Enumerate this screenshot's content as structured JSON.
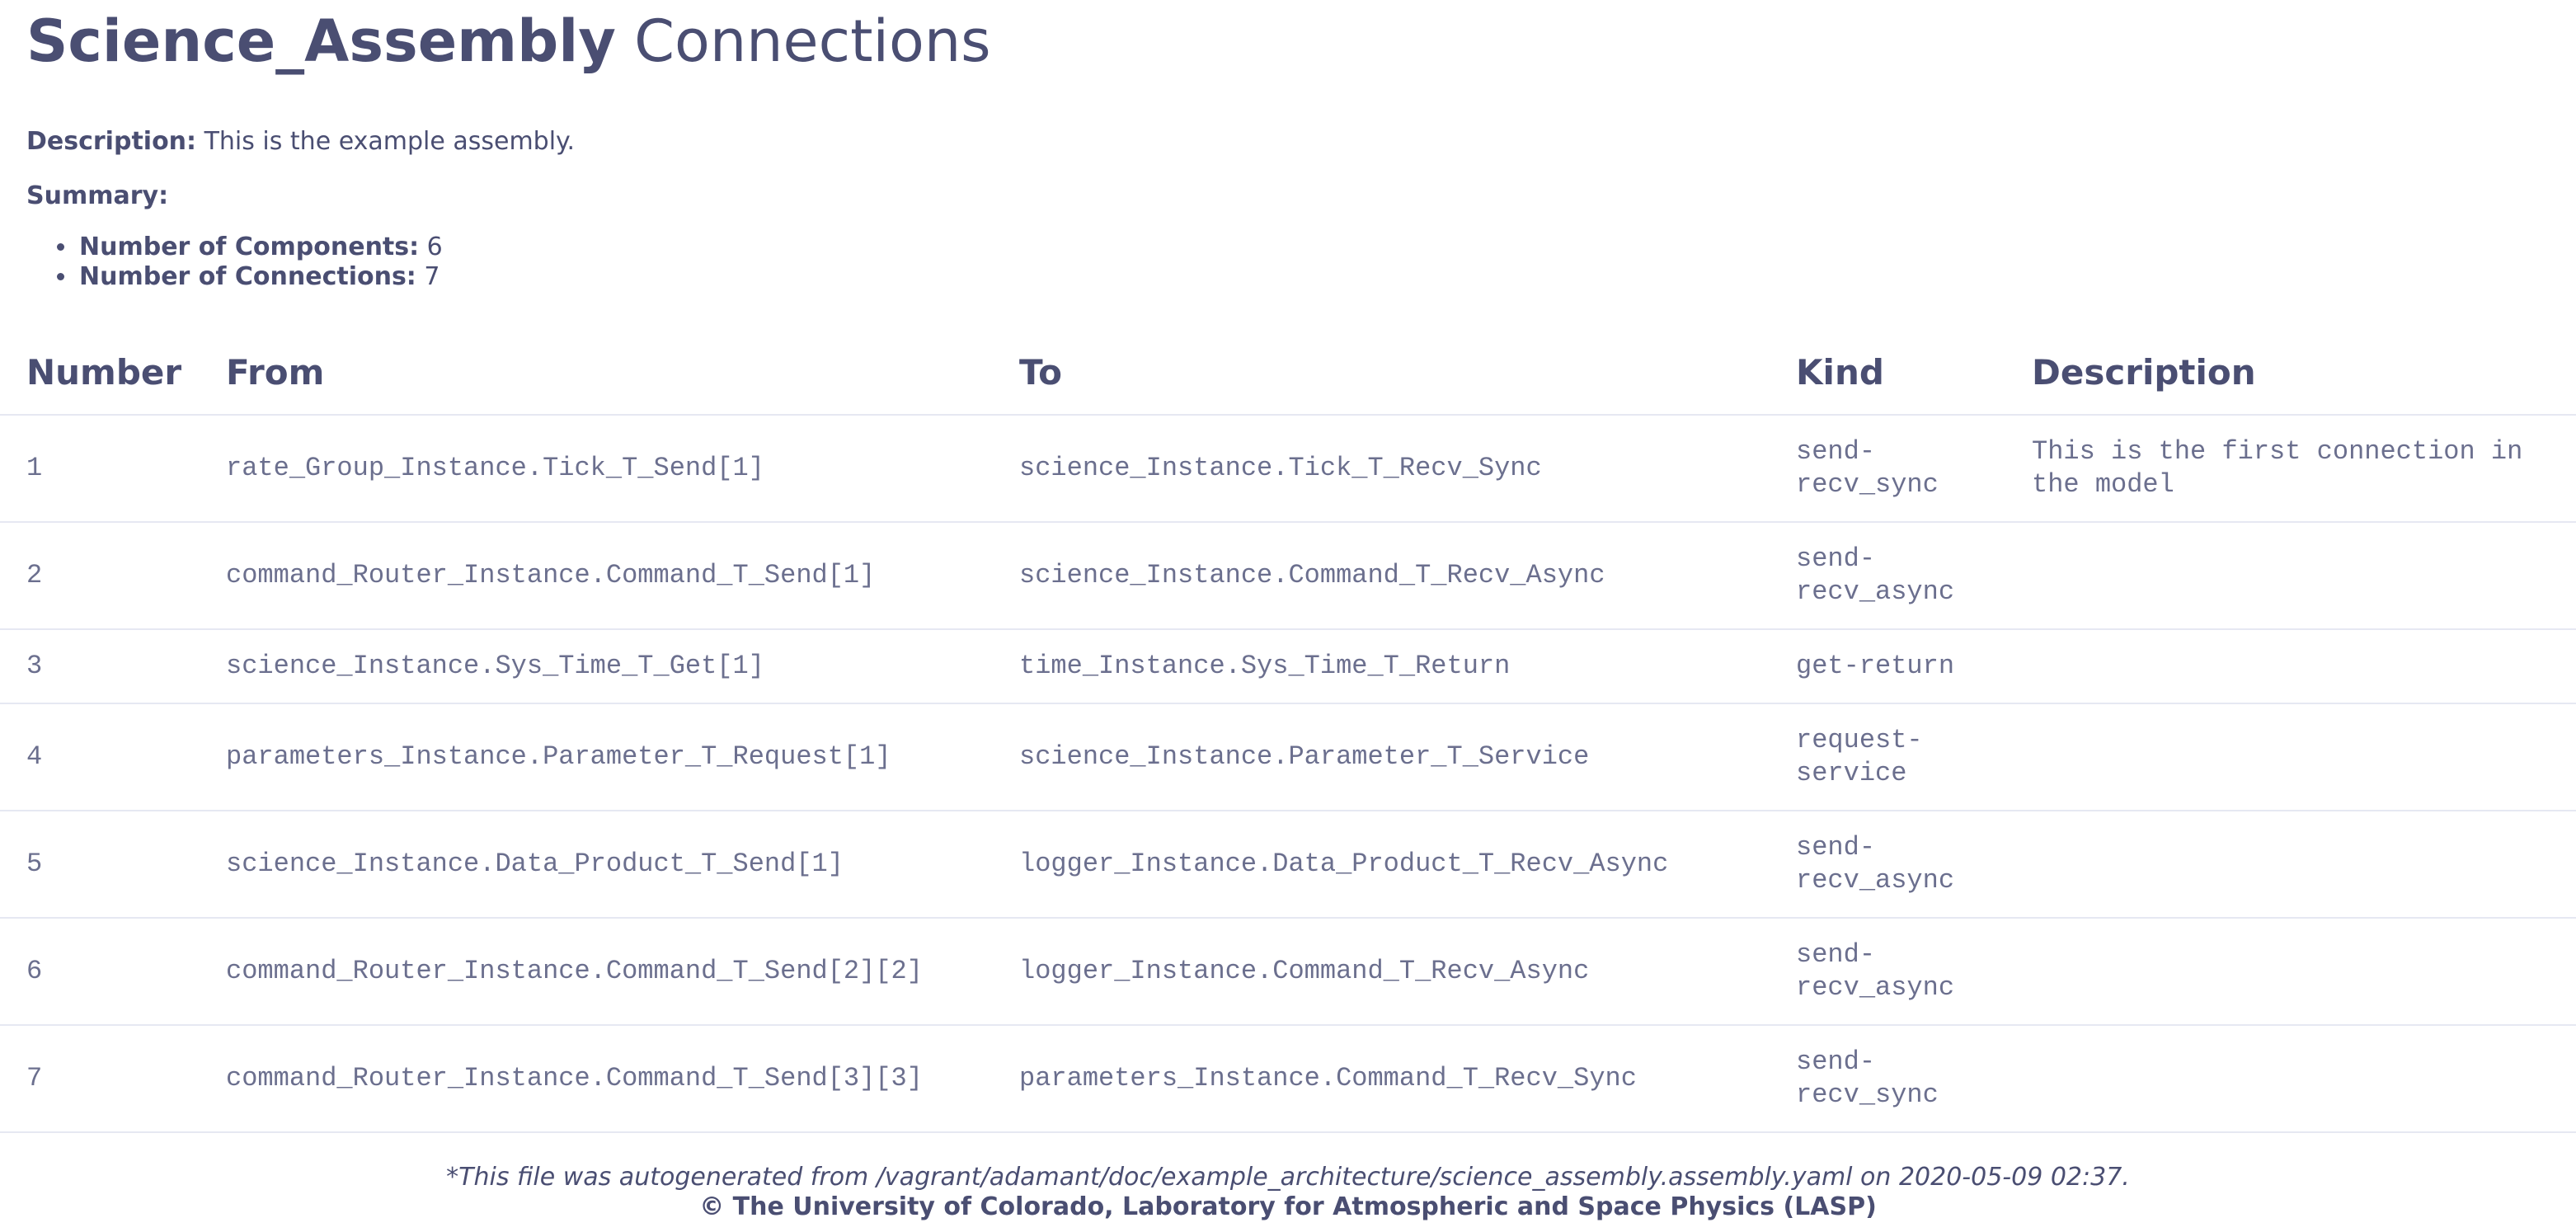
{
  "title": {
    "bold": "Science_Assembly",
    "rest": "Connections"
  },
  "description": {
    "label": "Description:",
    "text": "This is the example assembly."
  },
  "summary": {
    "label": "Summary:",
    "components_label": "Number of Components:",
    "components_value": "6",
    "connections_label": "Number of Connections:",
    "connections_value": "7"
  },
  "table": {
    "headers": [
      "Number",
      "From",
      "To",
      "Kind",
      "Description"
    ],
    "rows": [
      {
        "number": "1",
        "from": "rate_Group_Instance.Tick_T_Send[1]",
        "to": "science_Instance.Tick_T_Recv_Sync",
        "kind": "send-recv_sync",
        "description": "This is the first connection in the model"
      },
      {
        "number": "2",
        "from": "command_Router_Instance.Command_T_Send[1]",
        "to": "science_Instance.Command_T_Recv_Async",
        "kind": "send-recv_async",
        "description": ""
      },
      {
        "number": "3",
        "from": "science_Instance.Sys_Time_T_Get[1]",
        "to": "time_Instance.Sys_Time_T_Return",
        "kind": "get-return",
        "description": ""
      },
      {
        "number": "4",
        "from": "parameters_Instance.Parameter_T_Request[1]",
        "to": "science_Instance.Parameter_T_Service",
        "kind": "request-service",
        "description": ""
      },
      {
        "number": "5",
        "from": "science_Instance.Data_Product_T_Send[1]",
        "to": "logger_Instance.Data_Product_T_Recv_Async",
        "kind": "send-recv_async",
        "description": ""
      },
      {
        "number": "6",
        "from": "command_Router_Instance.Command_T_Send[2][2]",
        "to": "logger_Instance.Command_T_Recv_Async",
        "kind": "send-recv_async",
        "description": ""
      },
      {
        "number": "7",
        "from": "command_Router_Instance.Command_T_Send[3][3]",
        "to": "parameters_Instance.Command_T_Recv_Sync",
        "kind": "send-recv_sync",
        "description": ""
      }
    ]
  },
  "footer": {
    "note": "*This file was autogenerated from /vagrant/adamant/doc/example_architecture/science_assembly.assembly.yaml on 2020-05-09 02:37.",
    "copyright": "© The University of Colorado, Laboratory for Atmospheric and Space Physics (LASP)"
  }
}
